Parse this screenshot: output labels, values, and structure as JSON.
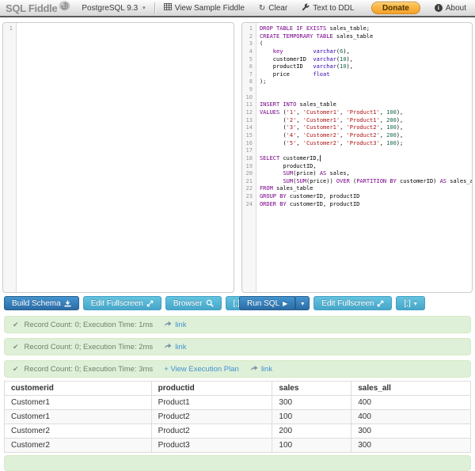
{
  "header": {
    "logo_text": "SQL Fiddle",
    "db_version": "PostgreSQL 9.3",
    "view_sample_label": "View Sample Fiddle",
    "clear_label": "Clear",
    "text_to_ddl_label": "Text to DDL",
    "donate_label": "Donate",
    "about_label": "About"
  },
  "schema_panel": {
    "line_numbers": [
      "1"
    ],
    "content": ""
  },
  "query_panel": {
    "cursor_line": 18,
    "lines": [
      [
        [
          "kw",
          "DROP TABLE IF EXISTS"
        ],
        [
          "pl",
          " sales_table;"
        ]
      ],
      [
        [
          "kw",
          "CREATE TEMPORARY TABLE"
        ],
        [
          "pl",
          " sales_table"
        ]
      ],
      [
        [
          "pl",
          "("
        ]
      ],
      [
        [
          "pl",
          "    "
        ],
        [
          "kw",
          "key"
        ],
        [
          "pl",
          "         "
        ],
        [
          "bi",
          "varchar"
        ],
        [
          "pl",
          "("
        ],
        [
          "num",
          "6"
        ],
        [
          "pl",
          "),"
        ]
      ],
      [
        [
          "pl",
          "    customerID  "
        ],
        [
          "bi",
          "varchar"
        ],
        [
          "pl",
          "("
        ],
        [
          "num",
          "10"
        ],
        [
          "pl",
          "),"
        ]
      ],
      [
        [
          "pl",
          "    productID   "
        ],
        [
          "bi",
          "varchar"
        ],
        [
          "pl",
          "("
        ],
        [
          "num",
          "10"
        ],
        [
          "pl",
          "),"
        ]
      ],
      [
        [
          "pl",
          "    price       "
        ],
        [
          "bi",
          "float"
        ]
      ],
      [
        [
          "pl",
          ");"
        ]
      ],
      [],
      [],
      [
        [
          "kw",
          "INSERT INTO"
        ],
        [
          "pl",
          " sales_table"
        ]
      ],
      [
        [
          "kw",
          "VALUES"
        ],
        [
          "pl",
          " ("
        ],
        [
          "str",
          "'1'"
        ],
        [
          "pl",
          ", "
        ],
        [
          "str",
          "'Customer1'"
        ],
        [
          "pl",
          ", "
        ],
        [
          "str",
          "'Product1'"
        ],
        [
          "pl",
          ", "
        ],
        [
          "num",
          "100"
        ],
        [
          "pl",
          "),"
        ]
      ],
      [
        [
          "pl",
          "       ("
        ],
        [
          "str",
          "'2'"
        ],
        [
          "pl",
          ", "
        ],
        [
          "str",
          "'Customer1'"
        ],
        [
          "pl",
          ", "
        ],
        [
          "str",
          "'Product1'"
        ],
        [
          "pl",
          ", "
        ],
        [
          "num",
          "200"
        ],
        [
          "pl",
          "),"
        ]
      ],
      [
        [
          "pl",
          "       ("
        ],
        [
          "str",
          "'3'"
        ],
        [
          "pl",
          ", "
        ],
        [
          "str",
          "'Customer1'"
        ],
        [
          "pl",
          ", "
        ],
        [
          "str",
          "'Product2'"
        ],
        [
          "pl",
          ", "
        ],
        [
          "num",
          "100"
        ],
        [
          "pl",
          "),"
        ]
      ],
      [
        [
          "pl",
          "       ("
        ],
        [
          "str",
          "'4'"
        ],
        [
          "pl",
          ", "
        ],
        [
          "str",
          "'Customer2'"
        ],
        [
          "pl",
          ", "
        ],
        [
          "str",
          "'Product2'"
        ],
        [
          "pl",
          ", "
        ],
        [
          "num",
          "200"
        ],
        [
          "pl",
          "),"
        ]
      ],
      [
        [
          "pl",
          "       ("
        ],
        [
          "str",
          "'5'"
        ],
        [
          "pl",
          ", "
        ],
        [
          "str",
          "'Customer2'"
        ],
        [
          "pl",
          ", "
        ],
        [
          "str",
          "'Product3'"
        ],
        [
          "pl",
          ", "
        ],
        [
          "num",
          "100"
        ],
        [
          "pl",
          ");"
        ]
      ],
      [],
      [
        [
          "kw",
          "SELECT"
        ],
        [
          "pl",
          " customerID,"
        ]
      ],
      [
        [
          "pl",
          "       productID,"
        ]
      ],
      [
        [
          "pl",
          "       "
        ],
        [
          "kw",
          "SUM"
        ],
        [
          "pl",
          "(price) "
        ],
        [
          "kw",
          "AS"
        ],
        [
          "pl",
          " sales,"
        ]
      ],
      [
        [
          "pl",
          "       "
        ],
        [
          "kw",
          "SUM"
        ],
        [
          "pl",
          "("
        ],
        [
          "kw",
          "SUM"
        ],
        [
          "pl",
          "(price)) "
        ],
        [
          "kw",
          "OVER"
        ],
        [
          "pl",
          " ("
        ],
        [
          "kw",
          "PARTITION BY"
        ],
        [
          "pl",
          " customerID) "
        ],
        [
          "kw",
          "AS"
        ],
        [
          "pl",
          " sales_all"
        ]
      ],
      [
        [
          "kw",
          "FROM"
        ],
        [
          "pl",
          " sales_table"
        ]
      ],
      [
        [
          "kw",
          "GROUP BY"
        ],
        [
          "pl",
          " customerID, productID"
        ]
      ],
      [
        [
          "kw",
          "ORDER BY"
        ],
        [
          "pl",
          " customerID, productID"
        ]
      ]
    ]
  },
  "buttons": {
    "build_schema": "Build Schema",
    "edit_fullscreen_left": "Edit Fullscreen",
    "browser": "Browser",
    "terminator_left": "[;]",
    "run_sql": "Run SQL",
    "edit_fullscreen_right": "Edit Fullscreen",
    "terminator_right": "[;]"
  },
  "results": [
    {
      "message": "Record Count: 0; Execution Time: 1ms",
      "link_label": "link"
    },
    {
      "message": "Record Count: 0; Execution Time: 2ms",
      "link_label": "link"
    },
    {
      "message": "Record Count: 0; Execution Time: 3ms",
      "view_plan_label": "View Execution Plan",
      "link_label": "link"
    }
  ],
  "result_table": {
    "headers": [
      "customerid",
      "productid",
      "sales",
      "sales_all"
    ],
    "rows": [
      [
        "Customer1",
        "Product1",
        "300",
        "400"
      ],
      [
        "Customer1",
        "Product2",
        "100",
        "400"
      ],
      [
        "Customer2",
        "Product2",
        "200",
        "300"
      ],
      [
        "Customer2",
        "Product3",
        "100",
        "300"
      ]
    ]
  },
  "icons": {
    "check": "✔",
    "caret": "▾",
    "play": "▶",
    "refresh": "↻",
    "expand": "↗",
    "download": "↓"
  },
  "colors": {
    "keyword": "#770088",
    "builtin": "#3300aa",
    "number": "#116644",
    "string": "#aa1111",
    "success_bg": "#dff0d8",
    "success_border": "#d6e9c6",
    "primary_btn": "#2c6ca6",
    "info_btn": "#47a5c8",
    "link": "#4292cf",
    "donate": "#f4a12b"
  }
}
